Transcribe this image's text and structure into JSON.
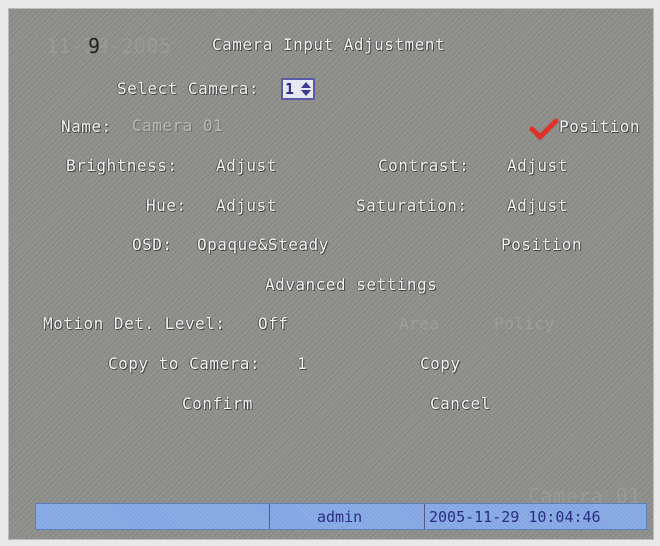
{
  "overlay": {
    "date": "11-29-2005",
    "camera": "Camera 01"
  },
  "title": "Camera Input Adjustment",
  "select_camera": {
    "label": "Select Camera:",
    "value": "1"
  },
  "name": {
    "label": "Name:",
    "value": "Camera 01"
  },
  "name_position": {
    "label": "Position",
    "checked": true,
    "check_color": "#e0302a"
  },
  "brightness": {
    "label": "Brightness:",
    "button": "Adjust"
  },
  "contrast": {
    "label": "Contrast:",
    "button": "Adjust"
  },
  "hue": {
    "label": "Hue:",
    "button": "Adjust"
  },
  "saturation": {
    "label": "Saturation:",
    "button": "Adjust"
  },
  "osd": {
    "label": "OSD:",
    "value": "Opaque&Steady",
    "position": "Position"
  },
  "advanced": "Advanced settings",
  "motion": {
    "label": "Motion Det. Level:",
    "value": "Off",
    "area": "Area",
    "policy": "Policy"
  },
  "copy": {
    "label": "Copy to Camera:",
    "value": "1",
    "button": "Copy"
  },
  "confirm": "Confirm",
  "cancel": "Cancel",
  "status": {
    "user": "admin",
    "datetime": "2005-11-29 10:04:46"
  },
  "colors": {
    "background": "#8e8e8a",
    "statusbar": "#82a6e2",
    "statustext": "#2c2c80",
    "text": "#f4f4f4"
  }
}
